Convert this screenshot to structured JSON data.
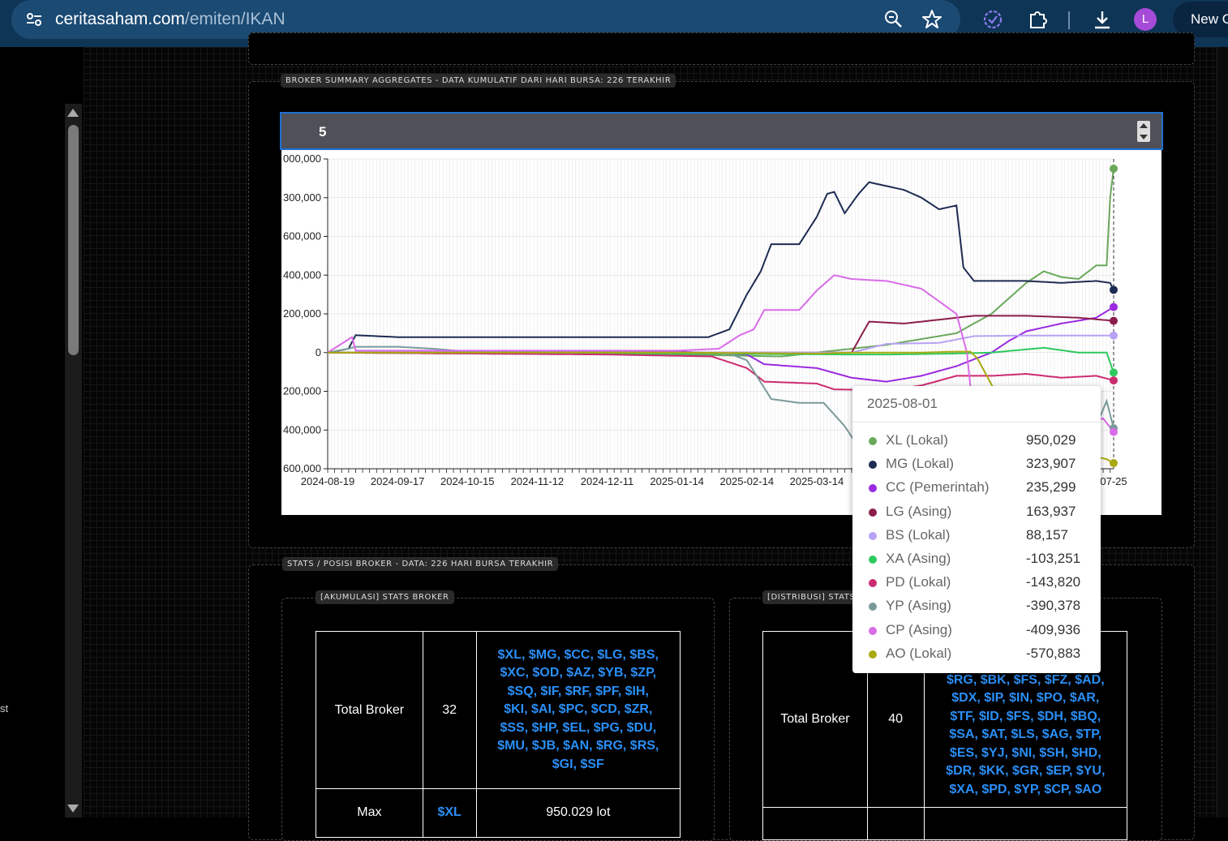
{
  "browser": {
    "url_domain": "ceritasaham.com",
    "url_path": "/emiten/IKAN",
    "avatar_letter": "L",
    "new_button": "New C"
  },
  "sidebar": {
    "partial_text": "st"
  },
  "broker_summary": {
    "legend": "BROKER SUMMARY AGGREGATES - DATA KUMULATIF DARI HARI BURSA: 226 TERAKHIR",
    "spinner_value": "5"
  },
  "chart_data": {
    "type": "line",
    "y_tick_labels": [
      "000,000",
      "300,000",
      "600,000",
      "400,000",
      "200,000",
      "0",
      "200,000",
      "400,000",
      "600,000"
    ],
    "y_tick_values": [
      1000000,
      800000,
      600000,
      400000,
      200000,
      0,
      -200000,
      -400000,
      -600000
    ],
    "ylim": [
      -600000,
      1000000
    ],
    "x_tick_labels": [
      "2024-08-19",
      "2024-09-17",
      "2024-10-15",
      "2024-11-12",
      "2024-12-11",
      "2025-01-14",
      "2025-02-14",
      "2025-03-14",
      "07-25"
    ],
    "x_tick_index": [
      0,
      20,
      40,
      60,
      80,
      100,
      120,
      140,
      225
    ],
    "n_points": 226,
    "series": [
      {
        "name": "XL (Lokal)",
        "color": "#6aa85c",
        "points": [
          [
            0,
            0
          ],
          [
            40,
            -5000
          ],
          [
            100,
            -10000
          ],
          [
            130,
            -20000
          ],
          [
            140,
            0
          ],
          [
            160,
            40000
          ],
          [
            180,
            100000
          ],
          [
            190,
            200000
          ],
          [
            195,
            280000
          ],
          [
            200,
            360000
          ],
          [
            205,
            420000
          ],
          [
            210,
            390000
          ],
          [
            215,
            380000
          ],
          [
            220,
            450000
          ],
          [
            223,
            450000
          ],
          [
            224,
            800000
          ],
          [
            225,
            950029
          ]
        ]
      },
      {
        "name": "MG (Lokal)",
        "color": "#1e2b52",
        "points": [
          [
            0,
            0
          ],
          [
            6,
            20000
          ],
          [
            8,
            90000
          ],
          [
            20,
            80000
          ],
          [
            40,
            80000
          ],
          [
            80,
            80000
          ],
          [
            109,
            80000
          ],
          [
            115,
            120000
          ],
          [
            120,
            300000
          ],
          [
            124,
            420000
          ],
          [
            127,
            560000
          ],
          [
            135,
            560000
          ],
          [
            140,
            700000
          ],
          [
            143,
            820000
          ],
          [
            145,
            830000
          ],
          [
            148,
            720000
          ],
          [
            152,
            820000
          ],
          [
            155,
            880000
          ],
          [
            160,
            860000
          ],
          [
            165,
            840000
          ],
          [
            170,
            800000
          ],
          [
            175,
            740000
          ],
          [
            180,
            760000
          ],
          [
            182,
            440000
          ],
          [
            185,
            370000
          ],
          [
            200,
            370000
          ],
          [
            210,
            360000
          ],
          [
            220,
            370000
          ],
          [
            224,
            360000
          ],
          [
            225,
            323907
          ]
        ]
      },
      {
        "name": "CC (Pemerintah)",
        "color": "#9a2ae0",
        "points": [
          [
            0,
            0
          ],
          [
            100,
            5000
          ],
          [
            120,
            -10000
          ],
          [
            125,
            -60000
          ],
          [
            140,
            -80000
          ],
          [
            150,
            -130000
          ],
          [
            160,
            -150000
          ],
          [
            170,
            -120000
          ],
          [
            180,
            -70000
          ],
          [
            190,
            0
          ],
          [
            195,
            60000
          ],
          [
            200,
            110000
          ],
          [
            210,
            150000
          ],
          [
            220,
            180000
          ],
          [
            225,
            235299
          ]
        ]
      },
      {
        "name": "LG (Asing)",
        "color": "#8b1d4a",
        "points": [
          [
            0,
            0
          ],
          [
            100,
            0
          ],
          [
            150,
            0
          ],
          [
            155,
            160000
          ],
          [
            165,
            150000
          ],
          [
            175,
            170000
          ],
          [
            185,
            190000
          ],
          [
            200,
            190000
          ],
          [
            215,
            180000
          ],
          [
            225,
            163937
          ]
        ]
      },
      {
        "name": "BS (Lokal)",
        "color": "#b8a2f5",
        "points": [
          [
            0,
            0
          ],
          [
            100,
            0
          ],
          [
            150,
            0
          ],
          [
            160,
            45000
          ],
          [
            175,
            50000
          ],
          [
            185,
            85000
          ],
          [
            200,
            88000
          ],
          [
            225,
            88157
          ]
        ]
      },
      {
        "name": "XA (Asing)",
        "color": "#2ec95e",
        "points": [
          [
            0,
            0
          ],
          [
            100,
            -5000
          ],
          [
            150,
            -10000
          ],
          [
            160,
            -10000
          ],
          [
            180,
            -5000
          ],
          [
            190,
            0
          ],
          [
            205,
            25000
          ],
          [
            215,
            0
          ],
          [
            223,
            0
          ],
          [
            225,
            -103251
          ]
        ]
      },
      {
        "name": "PD (Lokal)",
        "color": "#cc2b70",
        "points": [
          [
            0,
            0
          ],
          [
            80,
            -10000
          ],
          [
            110,
            -20000
          ],
          [
            120,
            -80000
          ],
          [
            125,
            -150000
          ],
          [
            140,
            -160000
          ],
          [
            145,
            -190000
          ],
          [
            160,
            -195000
          ],
          [
            170,
            -170000
          ],
          [
            180,
            -120000
          ],
          [
            190,
            -120000
          ],
          [
            200,
            -110000
          ],
          [
            210,
            -130000
          ],
          [
            220,
            -120000
          ],
          [
            225,
            -143820
          ]
        ]
      },
      {
        "name": "YP (Asing)",
        "color": "#7a9a9a",
        "points": [
          [
            0,
            0
          ],
          [
            6,
            20000
          ],
          [
            8,
            30000
          ],
          [
            20,
            30000
          ],
          [
            30,
            20000
          ],
          [
            40,
            5000
          ],
          [
            100,
            0
          ],
          [
            115,
            -5000
          ],
          [
            120,
            -40000
          ],
          [
            127,
            -240000
          ],
          [
            135,
            -260000
          ],
          [
            142,
            -260000
          ],
          [
            148,
            -380000
          ],
          [
            152,
            -490000
          ],
          [
            155,
            -480000
          ],
          [
            165,
            -470000
          ],
          [
            175,
            -430000
          ],
          [
            185,
            -420000
          ],
          [
            200,
            -410000
          ],
          [
            210,
            -400000
          ],
          [
            220,
            -380000
          ],
          [
            223,
            -250000
          ],
          [
            225,
            -390378
          ]
        ]
      },
      {
        "name": "CP (Asing)",
        "color": "#d96be8",
        "points": [
          [
            0,
            0
          ],
          [
            7,
            80000
          ],
          [
            8,
            10000
          ],
          [
            100,
            10000
          ],
          [
            112,
            20000
          ],
          [
            118,
            90000
          ],
          [
            122,
            120000
          ],
          [
            125,
            220000
          ],
          [
            135,
            220000
          ],
          [
            140,
            320000
          ],
          [
            145,
            400000
          ],
          [
            150,
            380000
          ],
          [
            160,
            370000
          ],
          [
            170,
            330000
          ],
          [
            180,
            200000
          ],
          [
            183,
            0
          ],
          [
            185,
            -350000
          ],
          [
            200,
            -360000
          ],
          [
            215,
            -370000
          ],
          [
            222,
            -340000
          ],
          [
            225,
            -409936
          ]
        ]
      },
      {
        "name": "AO (Lokal)",
        "color": "#a9a910",
        "points": [
          [
            0,
            0
          ],
          [
            100,
            0
          ],
          [
            140,
            -5000
          ],
          [
            150,
            0
          ],
          [
            170,
            0
          ],
          [
            180,
            5000
          ],
          [
            184,
            5000
          ],
          [
            186,
            -30000
          ],
          [
            200,
            -500000
          ],
          [
            215,
            -520000
          ],
          [
            223,
            -550000
          ],
          [
            225,
            -570883
          ]
        ]
      }
    ],
    "hover_index": 225,
    "grid": true
  },
  "tooltip": {
    "date": "2025-08-01",
    "rows": [
      {
        "name": "XL (Lokal)",
        "value": "950,029",
        "color": "#6aa85c"
      },
      {
        "name": "MG (Lokal)",
        "value": "323,907",
        "color": "#1e2b52"
      },
      {
        "name": "CC (Pemerintah)",
        "value": "235,299",
        "color": "#9a2ae0"
      },
      {
        "name": "LG (Asing)",
        "value": "163,937",
        "color": "#8b1d4a"
      },
      {
        "name": "BS (Lokal)",
        "value": "88,157",
        "color": "#b8a2f5"
      },
      {
        "name": "XA (Asing)",
        "value": "-103,251",
        "color": "#2ec95e"
      },
      {
        "name": "PD (Lokal)",
        "value": "-143,820",
        "color": "#cc2b70"
      },
      {
        "name": "YP (Asing)",
        "value": "-390,378",
        "color": "#7a9a9a"
      },
      {
        "name": "CP (Asing)",
        "value": "-409,936",
        "color": "#d96be8"
      },
      {
        "name": "AO (Lokal)",
        "value": "-570,883",
        "color": "#a9a910"
      }
    ]
  },
  "stats": {
    "legend": "STATS / POSISI BROKER - DATA: 226 HARI BURSA TERAKHIR",
    "akumulasi": {
      "legend": "[AKUMULASI] STATS BROKER",
      "total_label": "Total Broker",
      "total_value": "32",
      "broker_lines": [
        "$XL, $MG, $CC, $LG, $BS,",
        "$XC, $OD, $AZ, $YB, $ZP,",
        "$SQ, $IF, $RF, $PF, $IH,",
        "$KI, $AI, $PC, $CD, $ZR,",
        "$SS, $HP, $EL, $PG, $DU,",
        "$MU, $JB, $AN, $RG, $RS,",
        "$GI, $SF"
      ],
      "max_label": "Max",
      "max_broker": "$XL",
      "max_value": "950.029 lot"
    },
    "distribusi": {
      "legend": "[DISTRIBUSI] STATS",
      "total_label": "Total Broker",
      "total_value": "40",
      "broker_lines": [
        "$RG, $BK, $FS, $FZ, $AD,",
        "$DX, $IP, $IN, $PO, $AR,",
        "$TF, $ID, $FS, $DH, $BQ,",
        "$SA, $AT, $LS, $AG, $TP,",
        "$ES, $YJ, $NI, $SH, $HD,",
        "$DR, $KK, $GR, $EP, $YU,",
        "$XA, $PD, $YP, $CP, $AO"
      ]
    }
  }
}
